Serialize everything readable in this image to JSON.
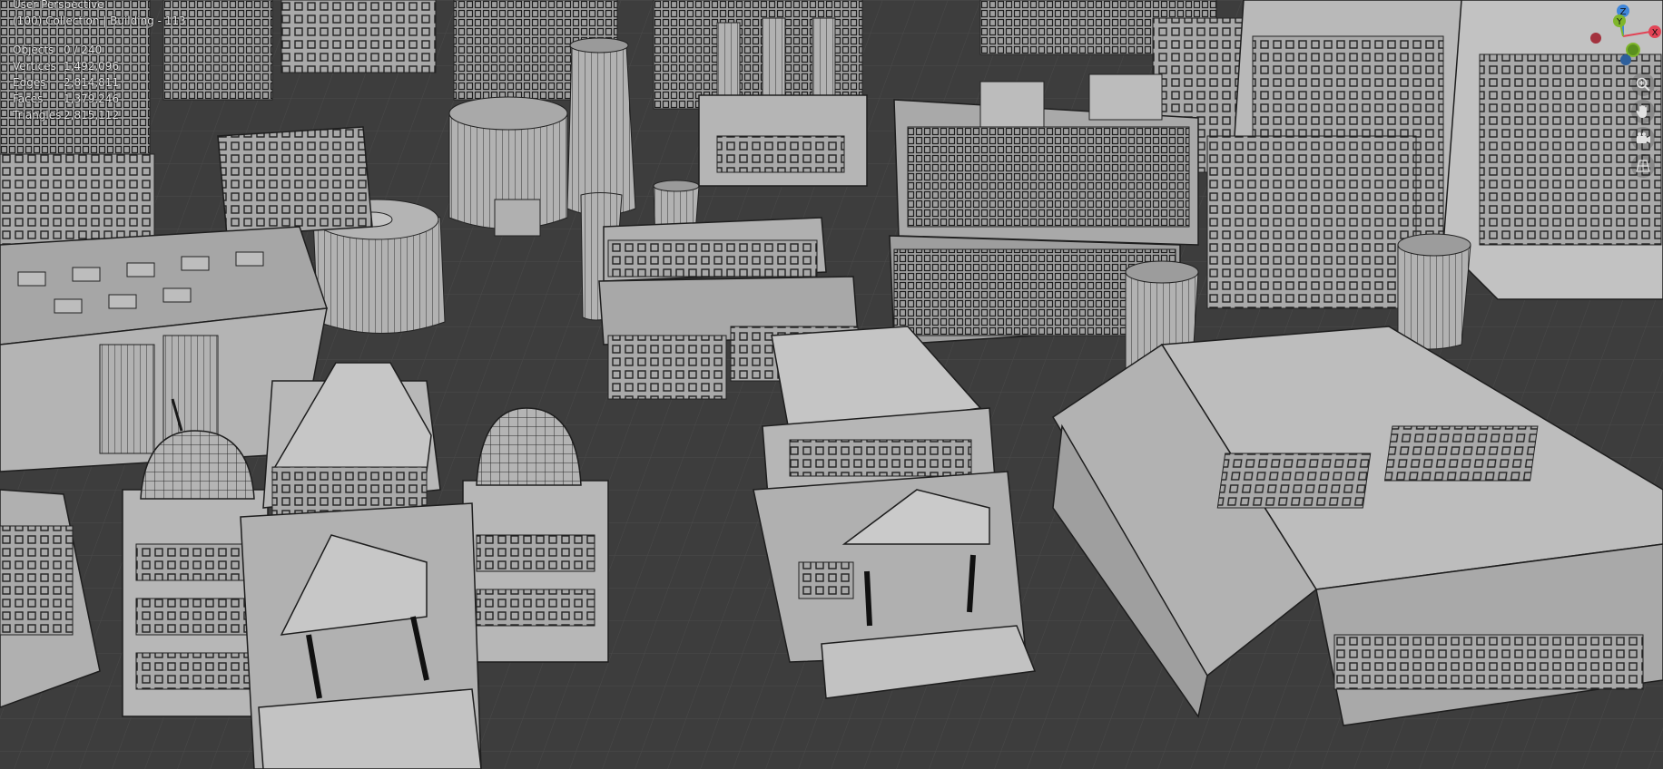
{
  "viewport": {
    "view_name": "User Perspective",
    "collection_info": "(100) Collection | Building - 113",
    "stats": [
      {
        "label": "Objects",
        "value": "0 / 240"
      },
      {
        "label": "Vertices",
        "value": "1,492,096"
      },
      {
        "label": "Edges",
        "value": "2,814,811"
      },
      {
        "label": "Faces",
        "value": "1,379,246"
      },
      {
        "label": "Triangles",
        "value": "2,815,112"
      }
    ]
  },
  "gizmo": {
    "x_label": "X",
    "y_label": "Y",
    "z_label": "Z",
    "colors": {
      "x": "#e24456",
      "y": "#7fb62b",
      "z": "#3f86d9"
    }
  },
  "navigation_tools": [
    {
      "name": "zoom-tool",
      "icon": "magnifier-plus-icon"
    },
    {
      "name": "pan-tool",
      "icon": "hand-icon"
    },
    {
      "name": "camera-view-tool",
      "icon": "camera-icon"
    },
    {
      "name": "perspective-toggle-tool",
      "icon": "grid-icon"
    }
  ]
}
